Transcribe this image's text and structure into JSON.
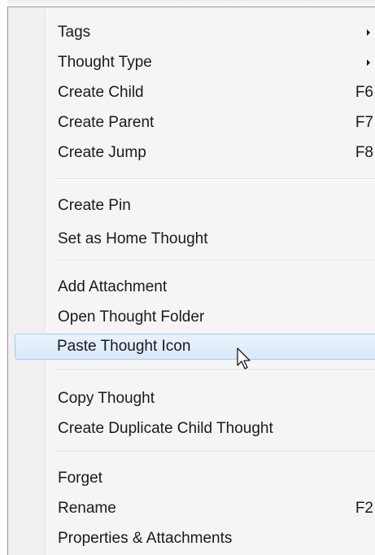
{
  "menu": {
    "group1": {
      "tags": {
        "label": "Tags"
      },
      "thought_type": {
        "label": "Thought Type"
      },
      "create_child": {
        "label": "Create Child",
        "shortcut": "F6"
      },
      "create_parent": {
        "label": "Create Parent",
        "shortcut": "F7"
      },
      "create_jump": {
        "label": "Create Jump",
        "shortcut": "F8"
      }
    },
    "group2": {
      "create_pin": {
        "label": "Create Pin"
      },
      "set_home": {
        "label": "Set as Home Thought"
      }
    },
    "group3": {
      "add_attachment": {
        "label": "Add Attachment"
      },
      "open_folder": {
        "label": "Open Thought Folder"
      },
      "paste_icon": {
        "label": "Paste Thought Icon"
      }
    },
    "group4": {
      "copy_thought": {
        "label": "Copy Thought"
      },
      "duplicate_child": {
        "label": "Create Duplicate Child Thought"
      }
    },
    "group5": {
      "forget": {
        "label": "Forget"
      },
      "rename": {
        "label": "Rename",
        "shortcut": "F2"
      },
      "properties": {
        "label": "Properties & Attachments"
      }
    },
    "highlighted_item": "Paste Thought Icon",
    "submenu_indicator_icon": "triangle-right-icon",
    "cursor_icon": "arrow-cursor-icon",
    "colors": {
      "background": "#f5f5f5",
      "highlight_top": "#eaf3fc",
      "highlight_bottom": "#d9e9f9",
      "highlight_border": "#a8cbee",
      "text": "#1a1a1a"
    }
  }
}
